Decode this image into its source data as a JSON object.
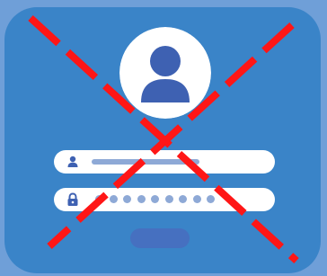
{
  "colors": {
    "page_background": "#6f9fd8",
    "card_background": "#3a84c8",
    "avatar_circle": "#ffffff",
    "avatar_figure": "#3e61b2",
    "field_background": "#ffffff",
    "field_icon": "#3e61b2",
    "placeholder_bar": "#8ea9d6",
    "password_dot": "#8ea9d6",
    "button": "#4670c0",
    "cross_mark": "#ff1616"
  },
  "icons": {
    "avatar": "user-avatar-icon",
    "username_field": "user-icon",
    "password_field": "padlock-icon",
    "overlay": "dashed-cross-mark"
  },
  "password": {
    "masked_character_count": 9
  }
}
